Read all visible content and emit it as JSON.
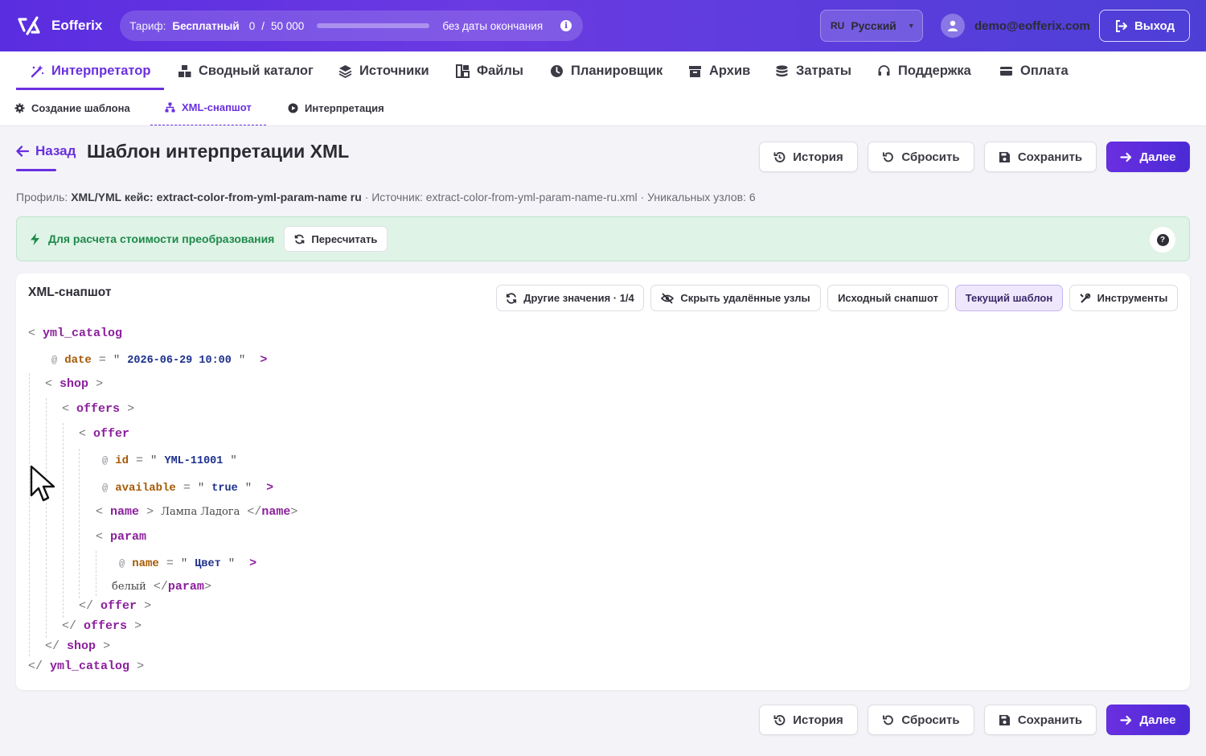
{
  "app": {
    "name": "Eofferix"
  },
  "tariff": {
    "label": "Тариф:",
    "plan": "Бесплатный",
    "used": "0",
    "separator": "/",
    "limit": "50 000",
    "usage_fraction": 0,
    "expiry": "без даты окончания"
  },
  "language": {
    "code": "RU",
    "name": "Русский"
  },
  "user": {
    "email": "demo@eofferix.com"
  },
  "logout_label": "Выход",
  "main_nav": [
    {
      "label": "Интерпретатор",
      "icon": "magic-wand-icon"
    },
    {
      "label": "Сводный каталог",
      "icon": "boxes-icon"
    },
    {
      "label": "Источники",
      "icon": "layers-icon"
    },
    {
      "label": "Файлы",
      "icon": "files-icon"
    },
    {
      "label": "Планировщик",
      "icon": "clock-icon"
    },
    {
      "label": "Архив",
      "icon": "archive-icon"
    },
    {
      "label": "Затраты",
      "icon": "coins-icon"
    },
    {
      "label": "Поддержка",
      "icon": "headset-icon"
    },
    {
      "label": "Оплата",
      "icon": "card-icon"
    }
  ],
  "sub_nav": [
    {
      "label": "Создание шаблона",
      "icon": "gear-icon"
    },
    {
      "label": "XML-снапшот",
      "icon": "sitemap-icon"
    },
    {
      "label": "Интерпретация",
      "icon": "play-icon"
    }
  ],
  "page": {
    "back_label": "Назад",
    "title": "Шаблон интерпретации XML",
    "buttons": {
      "history": "История",
      "reset": "Сбросить",
      "save": "Сохранить",
      "next": "Далее"
    },
    "profile": {
      "label": "Профиль:",
      "value": "XML/YML кейс: extract-color-from-yml-param-name ru",
      "source": "· Источник: extract-color-from-yml-param-name-ru.xml · Уникальных узлов: 6"
    }
  },
  "notice": {
    "text": "Для расчета стоимости преобразования",
    "recalc_label": "Пересчитать",
    "help": "?"
  },
  "snapshot": {
    "title": "XML-снапшот",
    "toolbar": {
      "other_values": "Другие значения · 1/4",
      "hide_deleted": "Скрыть удалённые узлы",
      "source_snapshot": "Исходный снапшот",
      "current_template": "Текущий шаблон",
      "tools": "Инструменты"
    },
    "xml": {
      "root": "yml_catalog",
      "date_attr": "date",
      "date_val": "2026-06-29 10:00",
      "shop": "shop",
      "offers": "offers",
      "offer": "offer",
      "id_attr": "id",
      "id_val": "YML-11001",
      "available_attr": "available",
      "available_val": "true",
      "name_tag": "name",
      "name_text": "Лампа Ладога",
      "param_tag": "param",
      "param_name_attr": "name",
      "param_name_val": "Цвет",
      "param_text": "белый"
    }
  }
}
